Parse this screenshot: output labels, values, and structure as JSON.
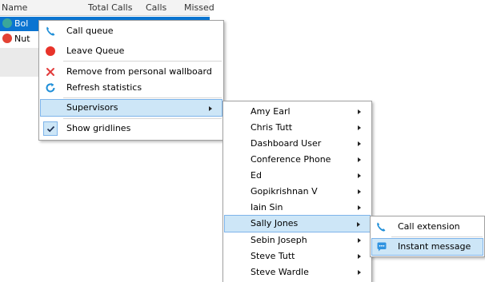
{
  "grid": {
    "columns": [
      "Name",
      "Total Calls",
      "Calls",
      "Missed"
    ],
    "rows": [
      {
        "name": "Bol",
        "status_color": "#3aa79a",
        "selected": true
      },
      {
        "name": "Nut",
        "status_color": "#e34234",
        "selected": false
      }
    ]
  },
  "context_menu": {
    "items": [
      {
        "label": "Call queue",
        "icon": "phone-icon"
      },
      {
        "label": "Leave Queue",
        "icon": "red-circle-icon"
      },
      {
        "label": "Remove from personal wallboard",
        "icon": "red-x-icon"
      },
      {
        "label": "Refresh statistics",
        "icon": "refresh-icon"
      },
      {
        "label": "Supervisors",
        "icon": "",
        "has_submenu": true,
        "highlighted": true
      },
      {
        "label": "Show gridlines",
        "icon": "checkmark-icon",
        "checked": true
      }
    ]
  },
  "supervisors_menu": {
    "items": [
      "Amy Earl",
      "Chris Tutt",
      "Dashboard User",
      "Conference Phone",
      "Ed",
      "Gopikrishnan V",
      "Iain Sin",
      "Sally Jones",
      "Sebin Joseph",
      "Steve Tutt",
      "Steve Wardle"
    ],
    "highlighted": "Sally Jones"
  },
  "contact_menu": {
    "items": [
      {
        "label": "Call extension",
        "icon": "phone-icon"
      },
      {
        "label": "Instant message",
        "icon": "chat-bubble-icon",
        "highlighted": true
      }
    ]
  },
  "colors": {
    "selection": "#0b74d1",
    "menu_highlight": "#cde6f7",
    "menu_highlight_border": "#7eb4ea"
  }
}
